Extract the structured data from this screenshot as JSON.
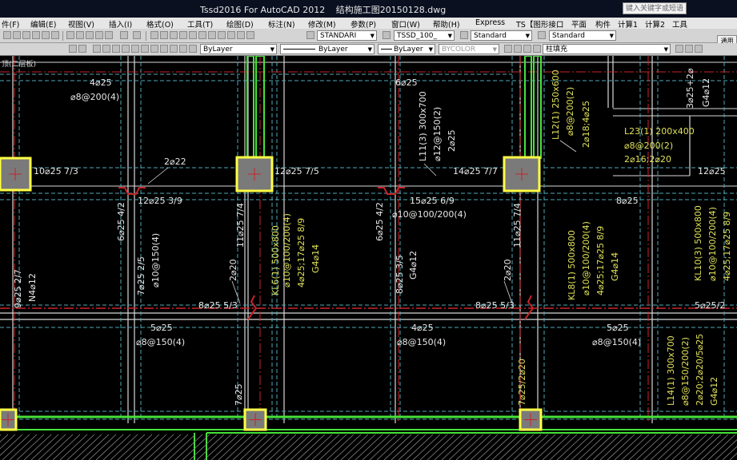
{
  "window": {
    "app_title": "Tssd2016 For AutoCAD 2012",
    "file_name": "结构施工图20150128.dwg",
    "search_placeholder": "键入关键字或短语"
  },
  "menu": [
    "件(F)",
    "编辑(E)",
    "视图(V)",
    "插入(I)",
    "格式(O)",
    "工具(T)",
    "绘图(D)",
    "标注(N)",
    "修改(M)",
    "参数(P)",
    "窗口(W)",
    "帮助(H)",
    "Express",
    "TS【图形接口",
    "平面",
    "构件",
    "计算1",
    "计算2",
    "工具"
  ],
  "toolbar_top": {
    "text_style": "STANDARI",
    "dim_style": "TSSD_100_",
    "table_style": "Standard",
    "multileader_style": "Standard"
  },
  "toolbar_props": {
    "layer_color": "ByLayer",
    "linetype": "ByLayer",
    "lineweight": "ByLayer",
    "plot_style": "BYCOLOR",
    "current_layer": "柱填充"
  },
  "palette_tab": "通用",
  "drawing": {
    "top_label": "顶(二层板)",
    "annotations": [
      {
        "t": "4⌀25"
      },
      {
        "t": "⌀8@200(4)"
      },
      {
        "t": "6⌀25"
      },
      {
        "t": "L11(3) 300x700"
      },
      {
        "t": "⌀12@150(2)"
      },
      {
        "t": "2⌀25"
      },
      {
        "t": "L12(1) 250x600"
      },
      {
        "t": "⌀8@200(2)"
      },
      {
        "t": "2⌀18;4⌀25"
      },
      {
        "t": "L23(1) 200x400"
      },
      {
        "t": "⌀8@200(2)"
      },
      {
        "t": "2⌀16;2⌀20"
      },
      {
        "t": "3⌀25+2⌀"
      },
      {
        "t": "G4⌀12"
      },
      {
        "t": "10⌀25 7/3"
      },
      {
        "t": "2⌀22"
      },
      {
        "t": "12⌀25 7/5"
      },
      {
        "t": "14⌀25 7/7"
      },
      {
        "t": "12⌀25"
      },
      {
        "t": "12⌀25 3/9"
      },
      {
        "t": "15⌀25 6/9"
      },
      {
        "t": "⌀10@100/200(4)"
      },
      {
        "t": "8⌀25"
      },
      {
        "t": "6⌀25 4/2"
      },
      {
        "t": "11⌀25 7/4"
      },
      {
        "t": "6⌀25 4/2"
      },
      {
        "t": "11⌀25 7/4"
      },
      {
        "t": "KL6(1) 500x800"
      },
      {
        "t": "⌀10@100/200(4)"
      },
      {
        "t": "4⌀25;17⌀25 8/9"
      },
      {
        "t": "G4⌀14"
      },
      {
        "t": "7⌀25 2/5"
      },
      {
        "t": "⌀10@150(4)"
      },
      {
        "t": "2⌀20"
      },
      {
        "t": "8⌀25 3/5"
      },
      {
        "t": "G4⌀12"
      },
      {
        "t": "2⌀20"
      },
      {
        "t": "KL8(1) 500x800"
      },
      {
        "t": "⌀10@100/200(4)"
      },
      {
        "t": "4⌀25;17⌀25 8/9"
      },
      {
        "t": "G4⌀14"
      },
      {
        "t": "KL10(3) 500x800"
      },
      {
        "t": "⌀10@100/200(4)"
      },
      {
        "t": "4⌀25;17⌀25 8/9"
      },
      {
        "t": "G4⌀14"
      },
      {
        "t": "9⌀25 2/7"
      },
      {
        "t": "N4⌀12"
      },
      {
        "t": "8⌀25 5/3"
      },
      {
        "t": "8⌀25 5/3"
      },
      {
        "t": "5⌀25/2"
      },
      {
        "t": "5⌀25"
      },
      {
        "t": "⌀8@150(4)"
      },
      {
        "t": "4⌀25"
      },
      {
        "t": "⌀8@150(4)"
      },
      {
        "t": "5⌀25"
      },
      {
        "t": "⌀8@150(4)"
      },
      {
        "t": "7⌀25"
      },
      {
        "t": "7⌀25/2⌀20"
      },
      {
        "t": "L14(1) 300x700"
      },
      {
        "t": "⌀8@150/200(2)"
      },
      {
        "t": "2⌀20;2⌀20/5⌀25"
      },
      {
        "t": "G4⌀12"
      }
    ]
  },
  "colors": {
    "canvas": "#000000",
    "grid_white": "#d8d8d8",
    "beam_dash": "#4fa8b8",
    "axis_red": "#c8242a",
    "column_yellow": "#ffff44",
    "wall_green": "#46e23a",
    "text_white": "#e8e8e8",
    "text_yellow": "#e0e05a"
  }
}
